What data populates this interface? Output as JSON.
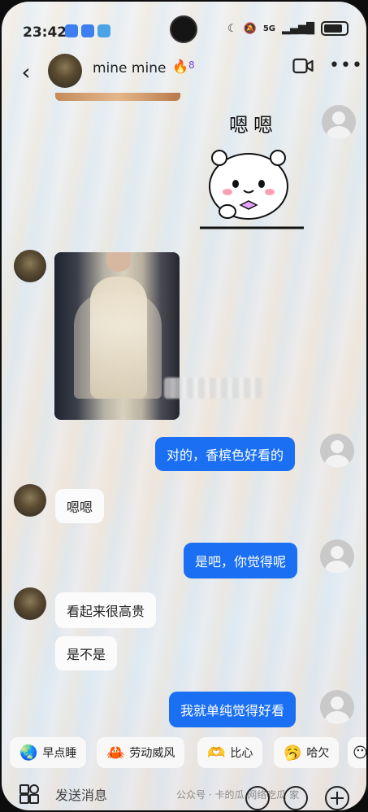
{
  "status_bar": {
    "time": "23:42",
    "signal_label": "5G",
    "app_icon_colors": [
      "#3d7ff0",
      "#3d7ff0",
      "#4aa4e6"
    ]
  },
  "header": {
    "name": "mine mine",
    "flame_icon": "flame-icon",
    "flame_count": "8"
  },
  "messages": [
    {
      "side": "other",
      "type": "sticker",
      "text": "嗯嗯"
    },
    {
      "side": "other",
      "type": "image",
      "alt_subject": "photo of woman in champagne satin slip dress"
    },
    {
      "side": "me",
      "type": "text",
      "text": "对的，香槟色好看的"
    },
    {
      "side": "other",
      "type": "text",
      "text": "嗯嗯"
    },
    {
      "side": "me",
      "type": "text",
      "text": "是吧，你觉得呢"
    },
    {
      "side": "other",
      "type": "text",
      "text": "看起来很高贵"
    },
    {
      "side": "other",
      "type": "text",
      "text": "是不是"
    },
    {
      "side": "me",
      "type": "text",
      "text": "我就单纯觉得好看"
    }
  ],
  "quick_replies": [
    {
      "icon": "globe-sleep-emoji",
      "label": "早点睡"
    },
    {
      "icon": "crab-emoji",
      "label": "劳动威风"
    },
    {
      "icon": "heart-hands-emoji",
      "label": "比心"
    },
    {
      "icon": "yawn-emoji",
      "label": "哈欠"
    }
  ],
  "composer": {
    "placeholder": "发送消息",
    "watermark": "公众号 · 卡的瓜 网络吃瓜 家"
  },
  "colors": {
    "my_bubble": "#1a6ff2",
    "their_bubble": "#fbfbfb",
    "flame": "#7b45d6"
  }
}
